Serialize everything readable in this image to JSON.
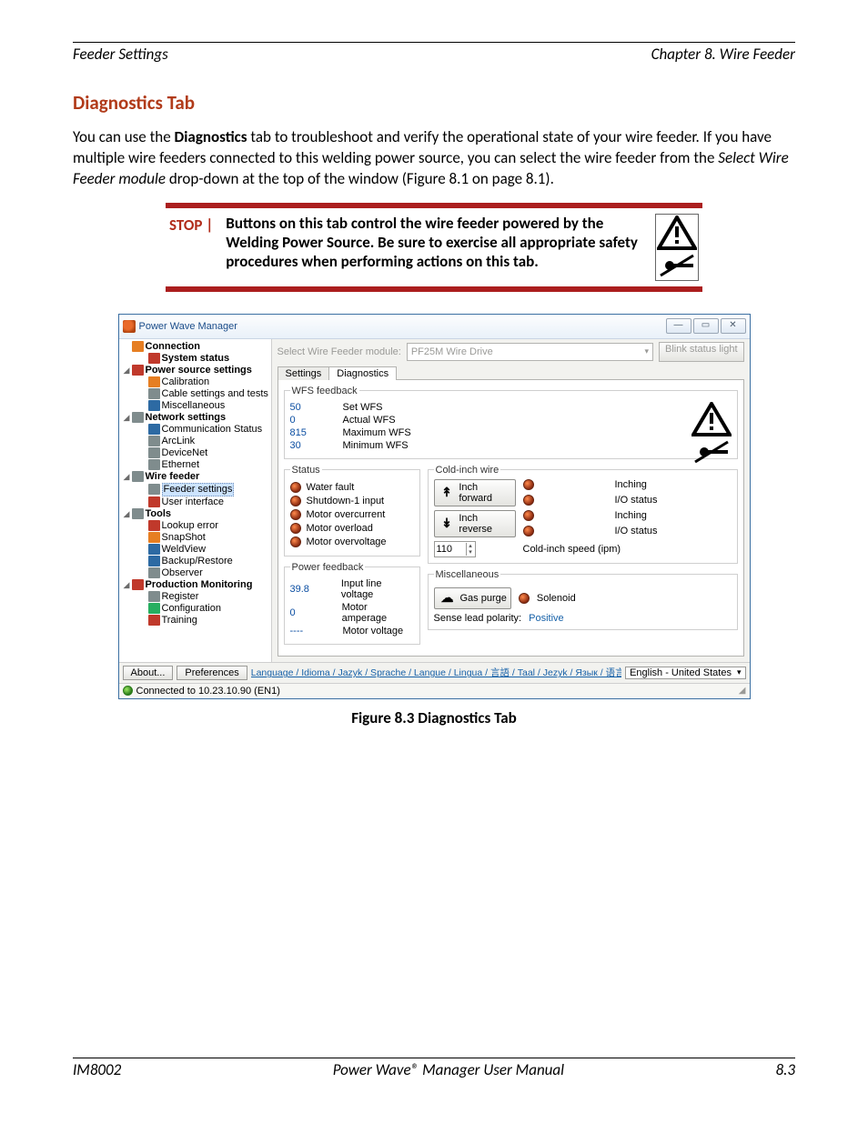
{
  "header": {
    "left": "Feeder Settings",
    "right": "Chapter 8. Wire Feeder"
  },
  "section_title": "Diagnostics Tab",
  "body_para": {
    "pre_bold": "You can use the ",
    "bold": "Diagnostics",
    "post_bold": " tab to troubleshoot and verify the operational state of your wire feeder.  If you have multiple wire feeders connected to this welding power source, you can select the wire feeder from the ",
    "italic": "Select Wire Feeder module",
    "tail": " drop-down at the top of the window (Figure 8.1 on page 8.1)."
  },
  "stop": {
    "label": "STOP   |",
    "text": "Buttons on this tab control the wire feeder powered by the Welding Power Source.  Be sure to exercise all appropriate safety procedures when performing actions on this tab."
  },
  "app": {
    "title": "Power Wave Manager",
    "tree": [
      {
        "label": "Connection",
        "cls": "bold",
        "icon": "ic-orange",
        "exp": ""
      },
      {
        "label": "System status",
        "cls": "bold",
        "icon": "ic-red",
        "indent": "child",
        "exp": ""
      },
      {
        "label": "Power source settings",
        "cls": "bold",
        "icon": "ic-red",
        "indent": "",
        "exp": "◢"
      },
      {
        "label": "Calibration",
        "icon": "ic-orange",
        "indent": "child"
      },
      {
        "label": "Cable settings and tests",
        "icon": "ic-grey",
        "indent": "child"
      },
      {
        "label": "Miscellaneous",
        "icon": "ic-blue",
        "indent": "child"
      },
      {
        "label": "Network settings",
        "cls": "bold",
        "icon": "ic-grey",
        "indent": "",
        "exp": "◢"
      },
      {
        "label": "Communication Status",
        "icon": "ic-blue",
        "indent": "child"
      },
      {
        "label": "ArcLink",
        "icon": "ic-grey",
        "indent": "child"
      },
      {
        "label": "DeviceNet",
        "icon": "ic-grey",
        "indent": "child"
      },
      {
        "label": "Ethernet",
        "icon": "ic-grey",
        "indent": "child"
      },
      {
        "label": "Wire feeder",
        "cls": "bold",
        "icon": "ic-grey",
        "indent": "",
        "exp": "◢"
      },
      {
        "label": "Feeder settings",
        "icon": "ic-grey",
        "indent": "child",
        "selected": true
      },
      {
        "label": "User interface",
        "icon": "ic-red",
        "indent": "child"
      },
      {
        "label": "Tools",
        "cls": "bold",
        "icon": "ic-grey",
        "indent": "",
        "exp": "◢"
      },
      {
        "label": "Lookup error",
        "icon": "ic-red",
        "indent": "child"
      },
      {
        "label": "SnapShot",
        "icon": "ic-orange",
        "indent": "child"
      },
      {
        "label": "WeldView",
        "icon": "ic-blue",
        "indent": "child"
      },
      {
        "label": "Backup/Restore",
        "icon": "ic-blue",
        "indent": "child"
      },
      {
        "label": "Observer",
        "icon": "ic-grey",
        "indent": "child"
      },
      {
        "label": "Production Monitoring",
        "cls": "bold",
        "icon": "ic-red",
        "indent": "",
        "exp": "◢"
      },
      {
        "label": "Register",
        "icon": "ic-grey",
        "indent": "child"
      },
      {
        "label": "Configuration",
        "icon": "ic-green",
        "indent": "child"
      },
      {
        "label": "Training",
        "icon": "ic-red",
        "indent": "child"
      }
    ],
    "top": {
      "select_label": "Select Wire Feeder module:",
      "module": "PF25M Wire Drive",
      "blink": "Blink status light"
    },
    "tabs": {
      "settings": "Settings",
      "diagnostics": "Diagnostics"
    },
    "groups": {
      "wfs_legend": "WFS feedback",
      "wfs": [
        {
          "val": "50",
          "label": "Set WFS"
        },
        {
          "val": "0",
          "label": "Actual WFS"
        },
        {
          "val": "815",
          "label": "Maximum WFS"
        },
        {
          "val": "30",
          "label": "Minimum WFS"
        }
      ],
      "status_legend": "Status",
      "status": [
        "Water fault",
        "Shutdown-1 input",
        "Motor overcurrent",
        "Motor overload",
        "Motor overvoltage"
      ],
      "cold_legend": "Cold-inch wire",
      "cold_fwd": "Inch forward",
      "cold_rev": "Inch reverse",
      "inching": "Inching",
      "iostatus": "I/O status",
      "spin_val": "110",
      "spin_label": "Cold-inch speed (ipm)",
      "power_legend": "Power feedback",
      "power": [
        {
          "val": "39.8",
          "label": "Input line voltage"
        },
        {
          "val": "0",
          "label": "Motor amperage"
        },
        {
          "val": "----",
          "label": "Motor voltage"
        }
      ],
      "misc_legend": "Miscellaneous",
      "gas_btn": "Gas purge",
      "solenoid": "Solenoid",
      "sense_label": "Sense lead polarity:",
      "sense_val": "Positive"
    },
    "bottom": {
      "about": "About...",
      "prefs": "Preferences",
      "lang_line": "Language / Idioma / Jazyk / Sprache / Langue / Lingua / 言語 / Taal / Jezyk / Язык / 语言",
      "lang_sel": "English - United States"
    },
    "status": "Connected to 10.23.10.90 (EN1)"
  },
  "figure_caption": "Figure 8.3    Diagnostics Tab",
  "footer": {
    "left": "IM8002",
    "center": "Power Wave® Manager User Manual",
    "right": "8.3"
  }
}
